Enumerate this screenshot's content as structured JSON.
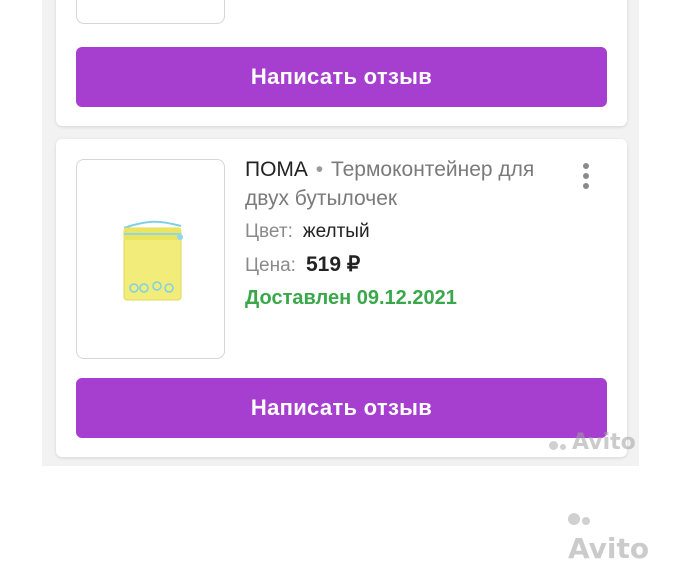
{
  "cards": [
    {
      "button_label": "Написать отзыв"
    },
    {
      "brand": "ПОМА",
      "separator": "•",
      "product_name": "Термоконтейнер для двух бутылочек",
      "color_label": "Цвет:",
      "color_value": "желтый",
      "price_label": "Цена:",
      "price_value": "519 ₽",
      "status": "Доставлен 09.12.2021",
      "button_label": "Написать отзыв"
    }
  ],
  "colors": {
    "accent": "#a63fd0",
    "status_green": "#3aa84a"
  },
  "icons": {
    "more": "kebab-vertical-icon"
  },
  "watermark": "Avito"
}
